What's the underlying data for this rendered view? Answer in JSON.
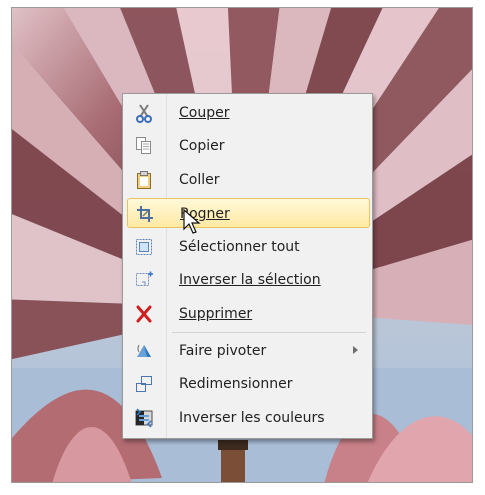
{
  "menu": {
    "items": [
      {
        "label": "Couper",
        "icon": "scissors-icon"
      },
      {
        "label": "Copier",
        "icon": "copy-icon"
      },
      {
        "label": "Coller",
        "icon": "paste-icon"
      },
      {
        "label": "Rogner",
        "icon": "crop-icon"
      },
      {
        "label": "Sélectionner tout",
        "icon": "select-all-icon"
      },
      {
        "label": "Inverser la sélection",
        "icon": "invert-selection-icon"
      },
      {
        "label": "Supprimer",
        "icon": "delete-icon"
      },
      {
        "label": "Faire pivoter",
        "icon": "rotate-icon"
      },
      {
        "label": "Redimensionner",
        "icon": "resize-icon"
      },
      {
        "label": "Inverser les couleurs",
        "icon": "invert-colors-icon"
      }
    ]
  },
  "colors": {
    "menu_bg": "#f1f1f1",
    "highlight_bg": "#ffe9a3",
    "highlight_border": "#e7c45c",
    "delete_red": "#d11f1f"
  }
}
